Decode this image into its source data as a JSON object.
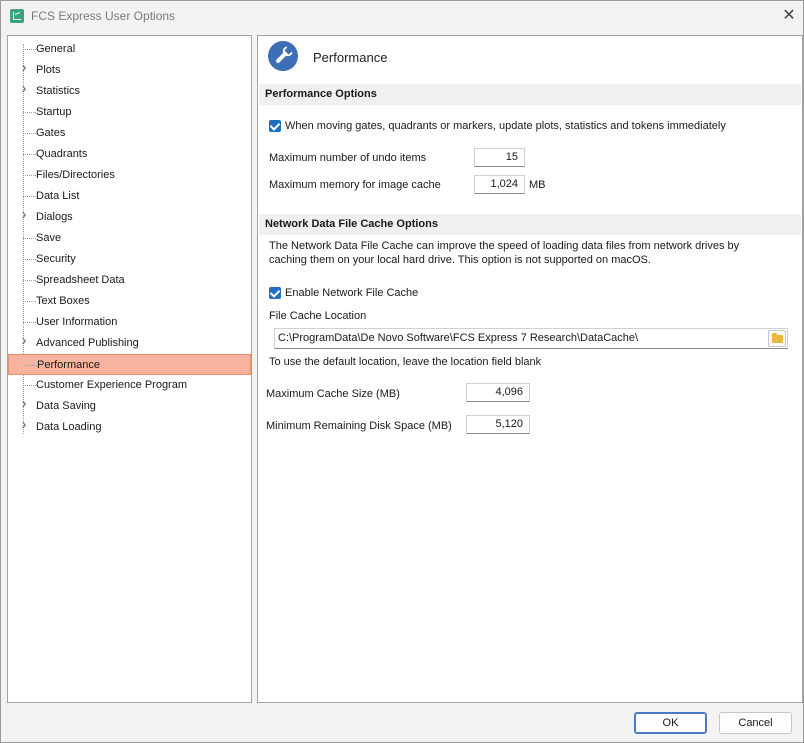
{
  "window": {
    "title": "FCS Express User Options",
    "close_glyph": "✕"
  },
  "sidebar": {
    "items": [
      {
        "label": "General",
        "expandable": false
      },
      {
        "label": "Plots",
        "expandable": true
      },
      {
        "label": "Statistics",
        "expandable": true
      },
      {
        "label": "Startup",
        "expandable": false
      },
      {
        "label": "Gates",
        "expandable": false
      },
      {
        "label": "Quadrants",
        "expandable": false
      },
      {
        "label": "Files/Directories",
        "expandable": false
      },
      {
        "label": "Data List",
        "expandable": false
      },
      {
        "label": "Dialogs",
        "expandable": true
      },
      {
        "label": "Save",
        "expandable": false
      },
      {
        "label": "Security",
        "expandable": false
      },
      {
        "label": "Spreadsheet Data",
        "expandable": false
      },
      {
        "label": "Text Boxes",
        "expandable": false
      },
      {
        "label": "User Information",
        "expandable": false
      },
      {
        "label": "Advanced Publishing",
        "expandable": true
      },
      {
        "label": "Performance",
        "expandable": false,
        "selected": true
      },
      {
        "label": "Customer Experience Program",
        "expandable": false
      },
      {
        "label": "Data Saving",
        "expandable": true
      },
      {
        "label": "Data Loading",
        "expandable": true
      }
    ]
  },
  "page": {
    "title": "Performance",
    "icon": "wrench-icon"
  },
  "performance_options": {
    "header": "Performance Options",
    "update_immediately_label": "When moving gates, quadrants or markers, update plots, statistics and tokens immediately",
    "update_immediately_checked": true,
    "undo_label": "Maximum number of undo items",
    "undo_value": "15",
    "image_cache_label": "Maximum memory for image cache",
    "image_cache_value": "1,024",
    "image_cache_unit": "MB"
  },
  "network_cache": {
    "header": "Network Data File Cache Options",
    "description_line1": "The Network Data File Cache can improve the speed of loading data files from network drives by",
    "description_line2": "caching them on your local hard drive. This option is not supported on macOS.",
    "enable_label": "Enable Network File Cache",
    "enable_checked": true,
    "location_label": "File Cache Location",
    "location_value": "C:\\ProgramData\\De Novo Software\\FCS Express 7 Research\\DataCache\\",
    "location_hint": "To use the default location, leave the location field blank",
    "max_size_label": "Maximum Cache Size (MB)",
    "max_size_value": "4,096",
    "min_disk_label": "Minimum Remaining Disk Space (MB)",
    "min_disk_value": "5,120"
  },
  "footer": {
    "ok_label": "OK",
    "cancel_label": "Cancel"
  },
  "colors": {
    "selected_bg": "#f6b49e",
    "checkbox_accent": "#1f6fc2",
    "icon_blue": "#3d6fb6"
  }
}
